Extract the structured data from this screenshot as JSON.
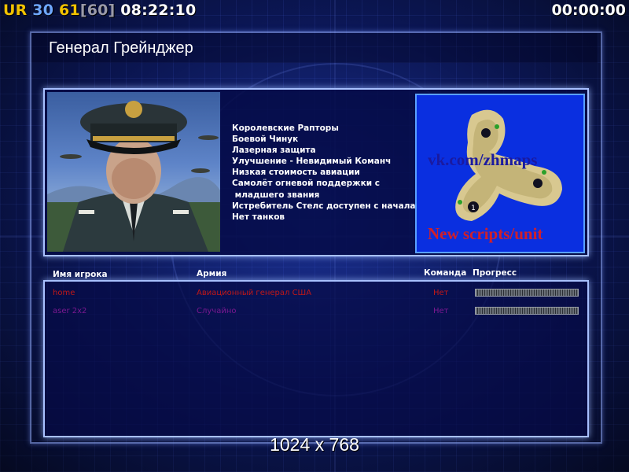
{
  "hud": {
    "ur": "UR",
    "stat_a": "30",
    "stat_b": "61",
    "stat_b_max": "[60]",
    "clock": "08:22:10",
    "timer": "00:00:00"
  },
  "general": {
    "name": "Генерал Грейнджер",
    "features": [
      "Королевские Рапторы",
      "Боевой Чинук",
      "Лазерная защита",
      "Улучшение - Невидимый Команч",
      "Низкая стоимость авиации",
      "Самолёт огневой поддержки с",
      " младшего звания",
      "Истребитель Стелс доступен с начала",
      "Нет танков"
    ]
  },
  "map": {
    "watermark_top": "vk.com/zhmaps",
    "watermark_bottom": "New scripts/unit",
    "start_marker": "1"
  },
  "players": {
    "headers": {
      "name": "Имя игрока",
      "army": "Армия",
      "team": "Команда",
      "progress": "Прогресс"
    },
    "rows": [
      {
        "name": "home",
        "army": "Авиационный генерал США",
        "team": "Нет",
        "color": "#c01818"
      },
      {
        "name": "aser 2x2",
        "army": "Случайно",
        "team": "Нет",
        "color": "#7a1890"
      }
    ]
  },
  "resolution": "1024 x 768",
  "colors": {
    "accent_gold": "#f2c200",
    "accent_blue": "#6fa8ff",
    "background": "#0b1650"
  }
}
